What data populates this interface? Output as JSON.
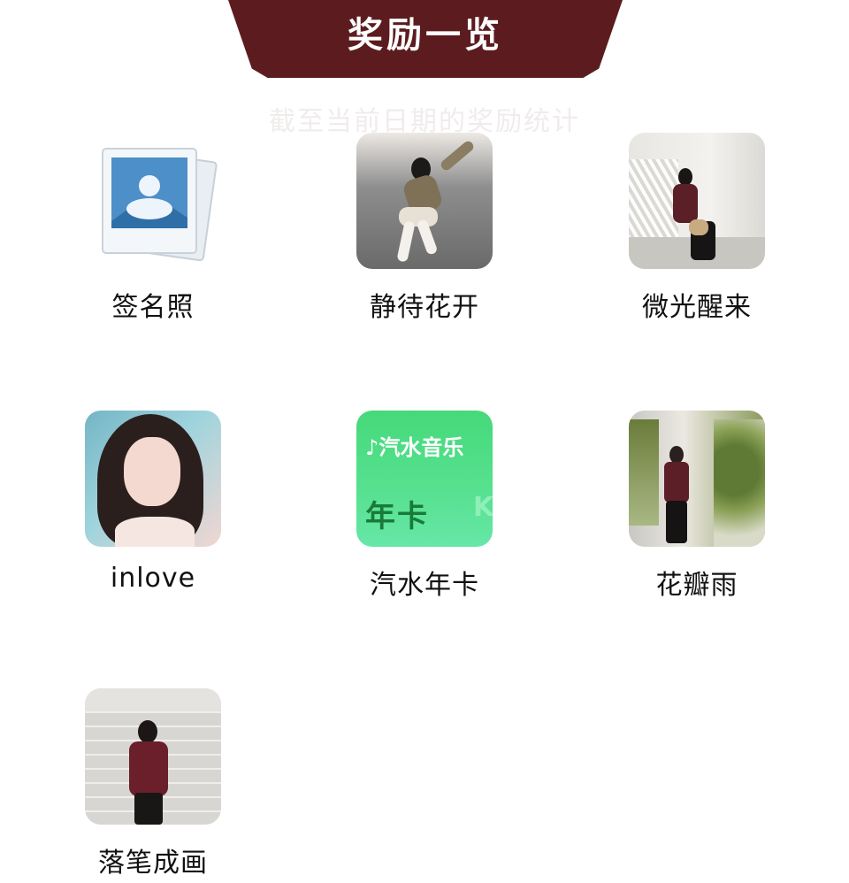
{
  "header": {
    "title": "奖励一览",
    "subtitle": "截至当前日期的奖励统计"
  },
  "colors": {
    "banner": "#5c1c1f",
    "card_green": "#4fdc84",
    "text": "#111111"
  },
  "rewards": [
    {
      "label": "签名照",
      "icon": "photo-stack-icon"
    },
    {
      "label": "静待花开",
      "icon": "photo-thumbnail"
    },
    {
      "label": "微光醒来",
      "icon": "photo-thumbnail"
    },
    {
      "label": "inlove",
      "icon": "photo-thumbnail"
    },
    {
      "label": "汽水年卡",
      "icon": "music-card",
      "brand": "汽水音乐",
      "card_text": "年卡"
    },
    {
      "label": "花瓣雨",
      "icon": "photo-thumbnail"
    },
    {
      "label": "落笔成画",
      "icon": "photo-thumbnail"
    }
  ]
}
